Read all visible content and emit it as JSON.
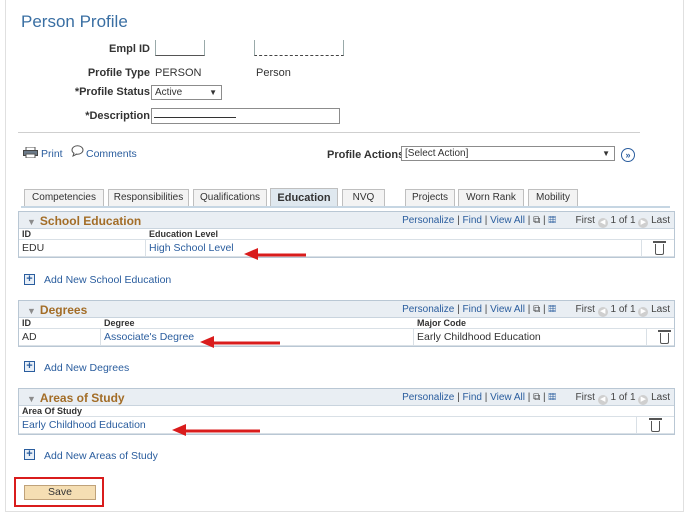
{
  "page": {
    "title": "Person Profile"
  },
  "fields": {
    "empl_id_label": "Empl ID",
    "profile_type_label": "Profile Type",
    "profile_type_value": "PERSON",
    "profile_type_desc": "Person",
    "profile_status_label": "*Profile Status",
    "profile_status_value": "Active",
    "description_label": "*Description"
  },
  "actions": {
    "print_label": "Print",
    "comments_label": "Comments",
    "profile_actions_label": "Profile Actions",
    "profile_actions_value": "[Select Action]"
  },
  "tabs": [
    {
      "label": "Competencies"
    },
    {
      "label": "Responsibilities"
    },
    {
      "label": "Qualifications"
    },
    {
      "label": "Education"
    },
    {
      "label": "NVQ"
    },
    {
      "label": "Projects"
    },
    {
      "label": "Worn Rank"
    },
    {
      "label": "Mobility"
    }
  ],
  "grid_tools": {
    "personalize": "Personalize",
    "find": "Find",
    "view_all": "View All",
    "first": "First",
    "count": "1 of 1",
    "last": "Last"
  },
  "school": {
    "title": "School Education",
    "col_id": "ID",
    "col_level": "Education Level",
    "row_id": "EDU",
    "row_level": "High School Level",
    "add_label": "Add New School Education"
  },
  "degrees": {
    "title": "Degrees",
    "col_id": "ID",
    "col_degree": "Degree",
    "col_major": "Major Code",
    "row_id": "AD",
    "row_degree": "Associate's Degree",
    "row_major": "Early Childhood Education",
    "add_label": "Add New Degrees"
  },
  "areas": {
    "title": "Areas of Study",
    "col_area": "Area Of Study",
    "row_area": "Early Childhood Education",
    "add_label": "Add New Areas of Study"
  },
  "save_label": "Save",
  "colors": {
    "link": "#2a5d9e",
    "section_title": "#a36d27",
    "highlight": "#d91c1c",
    "save_bg": "#f5deb3"
  }
}
